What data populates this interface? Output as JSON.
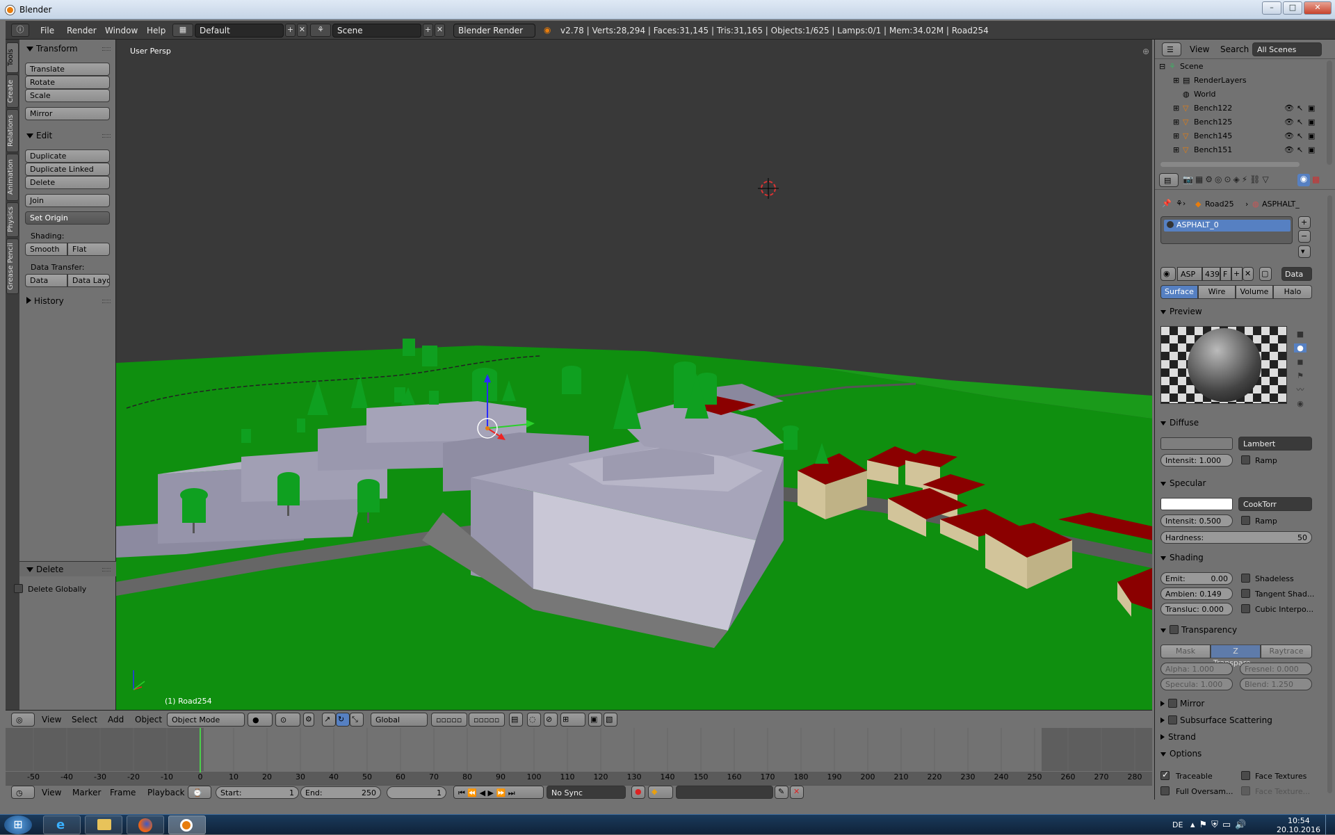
{
  "window": {
    "title": "Blender",
    "controls": [
      "–",
      "□",
      "✕"
    ]
  },
  "info_header": {
    "menus": [
      "File",
      "Render",
      "Window",
      "Help"
    ],
    "screen_layout": "Default",
    "scene": "Scene",
    "engine": "Blender Render",
    "stats": "v2.78 | Verts:28,294 | Faces:31,145 | Tris:31,165 | Objects:1/625 | Lamps:0/1 | Mem:34.02M | Road254"
  },
  "left_tabs": [
    "Tools",
    "Create",
    "Relations",
    "Animation",
    "Physics",
    "Grease Pencil"
  ],
  "toolshelf": {
    "transform": {
      "title": "Transform",
      "buttons": [
        "Translate",
        "Rotate",
        "Scale",
        "Mirror"
      ]
    },
    "edit": {
      "title": "Edit",
      "buttons": [
        "Duplicate",
        "Duplicate Linked",
        "Delete",
        "Join"
      ],
      "set_origin": "Set Origin",
      "shading_label": "Shading:",
      "smooth": "Smooth",
      "flat": "Flat",
      "data_transfer_label": "Data Transfer:",
      "data": "Data",
      "data_layout": "Data Layo"
    },
    "history": {
      "title": "History"
    },
    "operator": {
      "title": "Delete",
      "delete_globally": "Delete Globally"
    }
  },
  "viewport": {
    "view_label": "User Persp",
    "object_label": "(1) Road254"
  },
  "viewport_header": {
    "menus": [
      "View",
      "Select",
      "Add",
      "Object"
    ],
    "mode": "Object Mode",
    "orientation": "Global"
  },
  "timeline": {
    "ticks": [
      "-50",
      "-40",
      "-30",
      "-20",
      "-10",
      "0",
      "10",
      "20",
      "30",
      "40",
      "50",
      "60",
      "70",
      "80",
      "90",
      "100",
      "110",
      "120",
      "130",
      "140",
      "150",
      "160",
      "170",
      "180",
      "190",
      "200",
      "210",
      "220",
      "230",
      "240",
      "250",
      "260",
      "270",
      "280"
    ],
    "current_frame": 0,
    "menus": [
      "View",
      "Marker",
      "Frame",
      "Playback"
    ],
    "start_label": "Start:",
    "start": "1",
    "end_label": "End:",
    "end": "250",
    "frame": "1",
    "sync": "No Sync"
  },
  "outliner": {
    "menus": [
      "View",
      "Search"
    ],
    "filter": "All Scenes",
    "items": [
      "Scene",
      "RenderLayers",
      "World",
      "Bench122",
      "Bench125",
      "Bench145",
      "Bench151"
    ]
  },
  "properties": {
    "breadcrumb": [
      "Road25",
      "ASPHALT_"
    ],
    "material_slot": "ASPHALT_0",
    "material_name": "ASP",
    "users": "439",
    "fake_user": "F",
    "link": "Data",
    "tabs": [
      "Surface",
      "Wire",
      "Volume",
      "Halo"
    ],
    "preview": "Preview",
    "diffuse": {
      "title": "Diffuse",
      "shader": "Lambert",
      "intensity": "Intensit: 1.000",
      "ramp": "Ramp"
    },
    "specular": {
      "title": "Specular",
      "shader": "CookTorr",
      "intensity": "Intensit: 0.500",
      "ramp": "Ramp",
      "hardness_label": "Hardness:",
      "hardness": "50"
    },
    "shading": {
      "title": "Shading",
      "emit": "Emit:",
      "emit_val": "0.00",
      "ambient": "Ambien: 0.149",
      "transluc": "Transluc: 0.000",
      "shadeless": "Shadeless",
      "tangent": "Tangent Shad...",
      "cubic": "Cubic Interpo..."
    },
    "transparency": {
      "title": "Transparency",
      "modes": [
        "Mask",
        "Z Transpare...",
        "Raytrace"
      ],
      "alpha": "Alpha:  1.000",
      "fresnel": "Fresnel: 0.000",
      "specular": "Specula: 1.000",
      "blend": "Blend:  1.250"
    },
    "collapsed": [
      "Mirror",
      "Subsurface Scattering",
      "Strand"
    ],
    "options": {
      "title": "Options",
      "traceable": "Traceable",
      "face_textures": "Face Textures",
      "full_oversampling": "Full Oversam...",
      "face_texture_alpha": "Face Texture..."
    }
  },
  "taskbar": {
    "lang": "DE",
    "time": "10:54",
    "date": "20.10.2016"
  },
  "colors": {
    "grass": "#0f8f0f",
    "building": "#a8a4b6",
    "roof_red": "#8b0000",
    "tree": "#0fa020",
    "house_wall": "#d2c49a",
    "viewport_bg": "#393939",
    "highlight": "#5680c2"
  }
}
